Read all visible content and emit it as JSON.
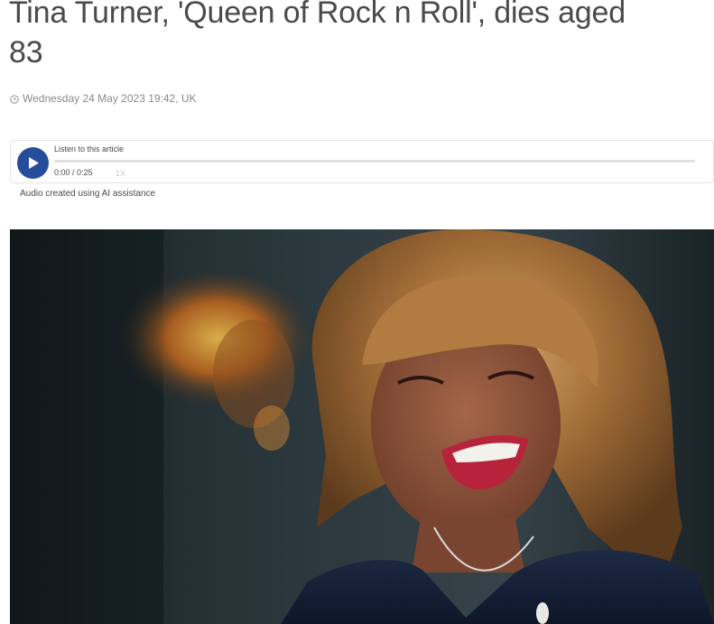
{
  "article": {
    "headline": "Tina Turner, 'Queen of Rock n Roll', dies aged 83",
    "timestamp": "Wednesday 24 May 2023 19:42, UK"
  },
  "audio_player": {
    "label": "Listen to this article",
    "time": "0:00 / 0:25",
    "speed": "1X",
    "progress": 0,
    "accent_color": "#254d9b"
  },
  "ai_note": "Audio created using AI assistance",
  "icons": {
    "timestamp": "clock-icon",
    "play": "play-icon"
  }
}
